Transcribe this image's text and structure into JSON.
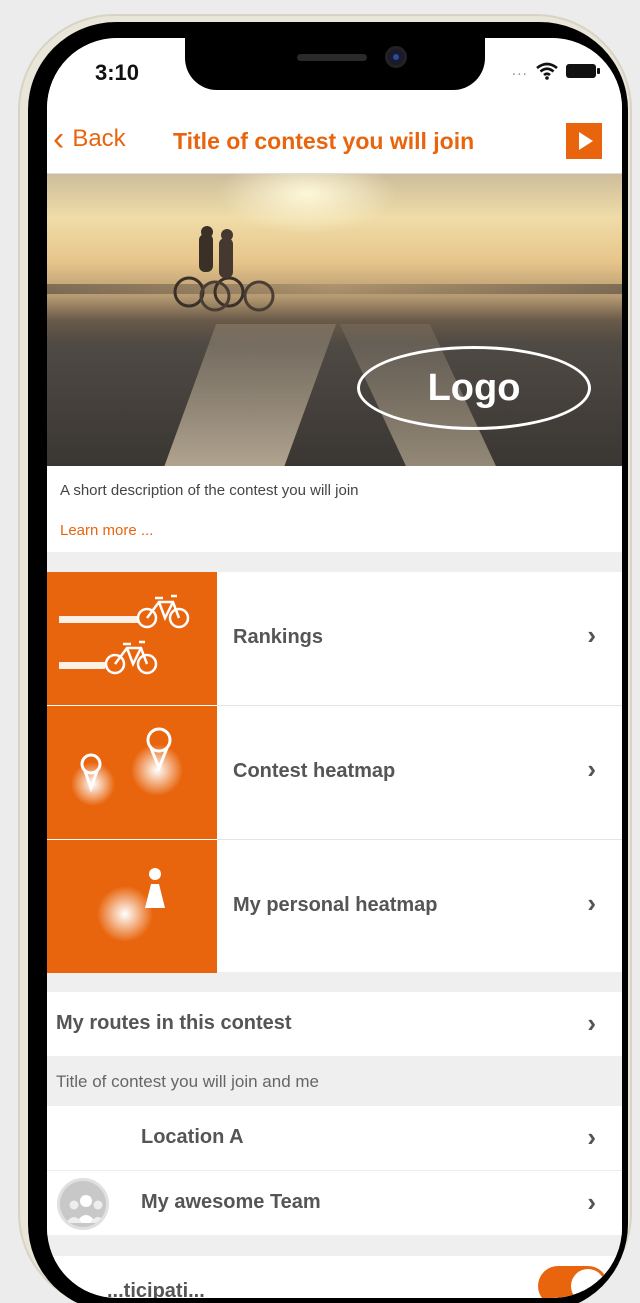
{
  "status": {
    "time": "3:10",
    "dots": "...",
    "icons": [
      "wifi-icon",
      "battery-icon"
    ]
  },
  "nav": {
    "back_label": "Back",
    "back_icon": "chevron-left-icon",
    "title": "Title of contest you will join",
    "action_icon": "play-icon"
  },
  "hero": {
    "logo_text": "Logo"
  },
  "description": {
    "text": "A short description of the contest you will join",
    "learn_more": "Learn more ..."
  },
  "features": [
    {
      "label": "Rankings",
      "icon": "bicycles-icon"
    },
    {
      "label": "Contest heatmap",
      "icon": "map-pins-icon"
    },
    {
      "label": "My personal heatmap",
      "icon": "person-heat-icon"
    }
  ],
  "routes_row": {
    "label": "My routes in this contest"
  },
  "section": {
    "title": "Title of contest you will join and me"
  },
  "list": [
    {
      "label": "Location A"
    },
    {
      "label": "My awesome Team",
      "icon": "group-avatar-icon"
    }
  ],
  "partial_row": {
    "label": "...ticipati..."
  },
  "colors": {
    "accent": "#e8650e",
    "background": "#efefef",
    "text": "#555555"
  }
}
